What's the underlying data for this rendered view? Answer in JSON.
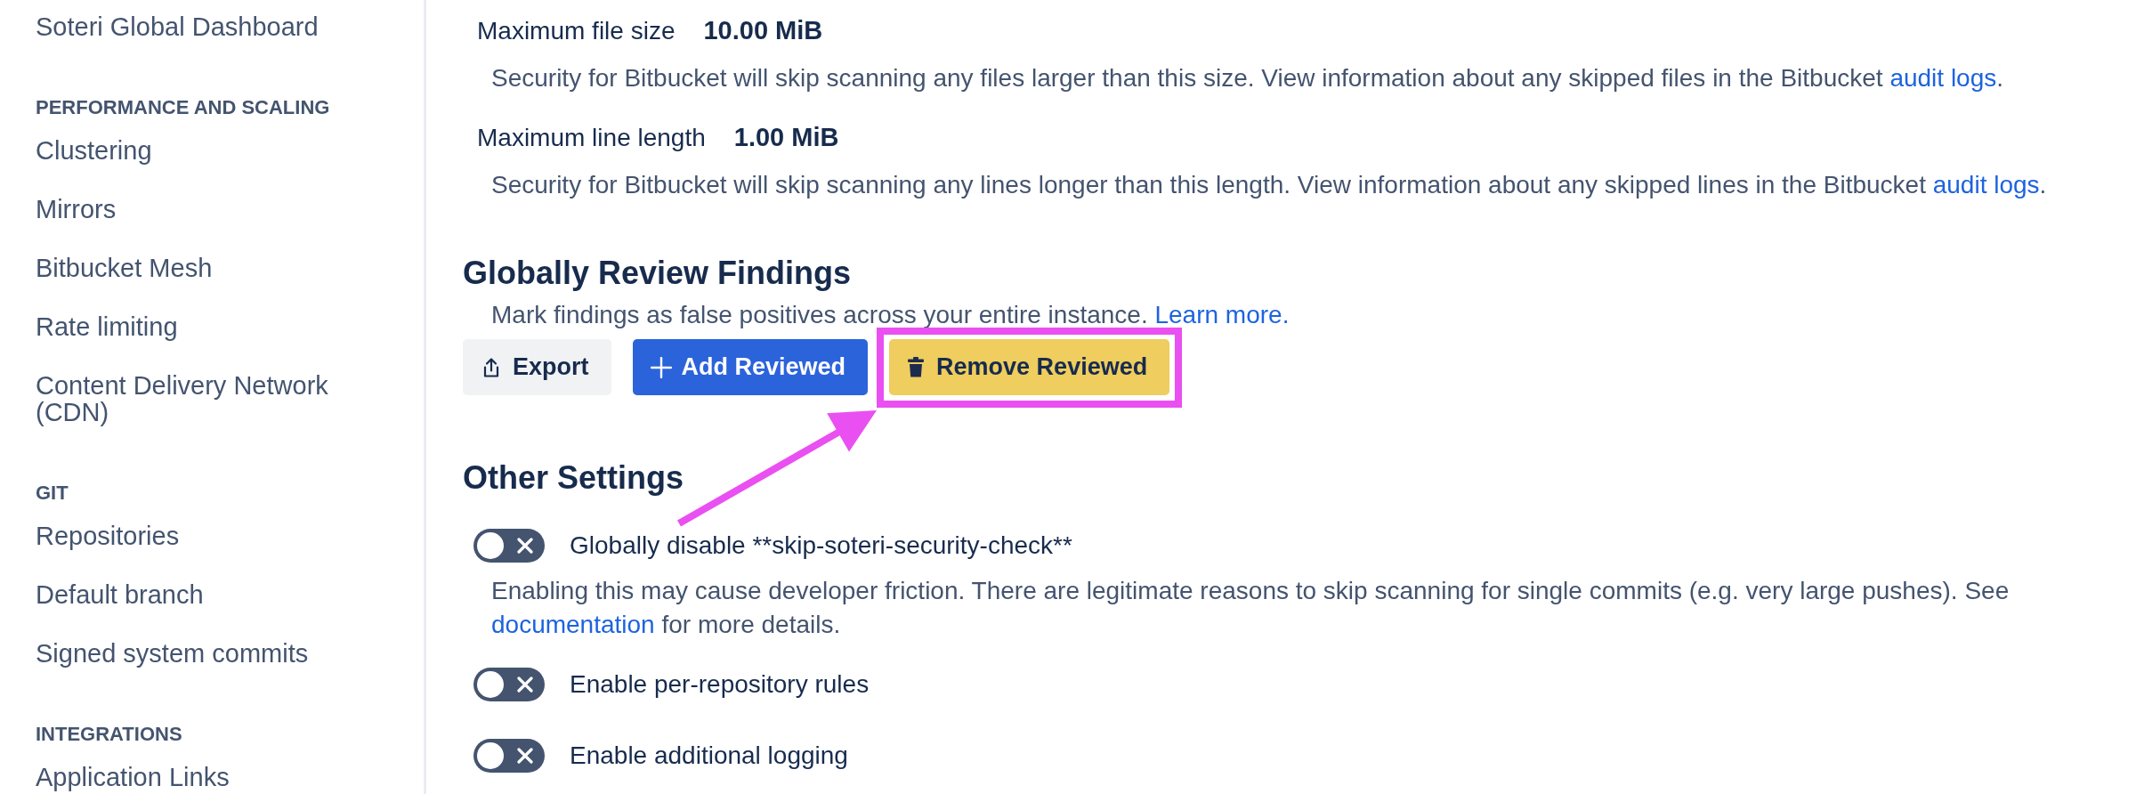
{
  "sidebar": {
    "items": [
      {
        "kind": "link",
        "label": "Soteri Global Dashboard"
      },
      {
        "kind": "heading",
        "label": "PERFORMANCE AND SCALING"
      },
      {
        "kind": "link",
        "label": "Clustering"
      },
      {
        "kind": "link",
        "label": "Mirrors"
      },
      {
        "kind": "link",
        "label": "Bitbucket Mesh"
      },
      {
        "kind": "link",
        "label": "Rate limiting"
      },
      {
        "kind": "link",
        "label": "Content Delivery Network (CDN)"
      },
      {
        "kind": "heading",
        "label": "GIT"
      },
      {
        "kind": "link",
        "label": "Repositories"
      },
      {
        "kind": "link",
        "label": "Default branch"
      },
      {
        "kind": "link",
        "label": "Signed system commits"
      },
      {
        "kind": "heading",
        "label": "INTEGRATIONS"
      },
      {
        "kind": "link",
        "label": "Application Links"
      }
    ]
  },
  "limits": [
    {
      "label": "Maximum file size",
      "value": "10.00 MiB",
      "description": [
        {
          "kind": "text",
          "text": "Security for Bitbucket will skip scanning any files larger than this size. View information about any skipped files in the Bitbucket "
        },
        {
          "kind": "link",
          "text": "audit logs"
        },
        {
          "kind": "text",
          "text": "."
        }
      ]
    },
    {
      "label": "Maximum line length",
      "value": "1.00 MiB",
      "description": [
        {
          "kind": "text",
          "text": "Security for Bitbucket will skip scanning any lines longer than this length. View information about any skipped lines in the Bitbucket "
        },
        {
          "kind": "link",
          "text": "audit logs"
        },
        {
          "kind": "text",
          "text": "."
        }
      ]
    }
  ],
  "review": {
    "title": "Globally Review Findings",
    "description": [
      {
        "kind": "text",
        "text": "Mark findings as false positives across your entire instance. "
      },
      {
        "kind": "link",
        "text": "Learn more."
      }
    ],
    "buttons": [
      {
        "kind": "export",
        "label": "Export",
        "highlighted": false
      },
      {
        "kind": "add",
        "label": "Add Reviewed",
        "highlighted": false
      },
      {
        "kind": "remove",
        "label": "Remove Reviewed",
        "highlighted": true
      }
    ]
  },
  "other_settings": {
    "title": "Other Settings",
    "settings": [
      {
        "label": "Globally disable **skip-soteri-security-check**",
        "on": false,
        "description": [
          {
            "kind": "text",
            "text": "Enabling this may cause developer friction. There are legitimate reasons to skip scanning for single commits (e.g. very large pushes). See "
          },
          {
            "kind": "link",
            "text": "documentation"
          },
          {
            "kind": "text",
            "text": " for more details."
          }
        ]
      },
      {
        "label": "Enable per-repository rules",
        "on": false
      },
      {
        "label": "Enable additional logging",
        "on": false
      }
    ]
  }
}
